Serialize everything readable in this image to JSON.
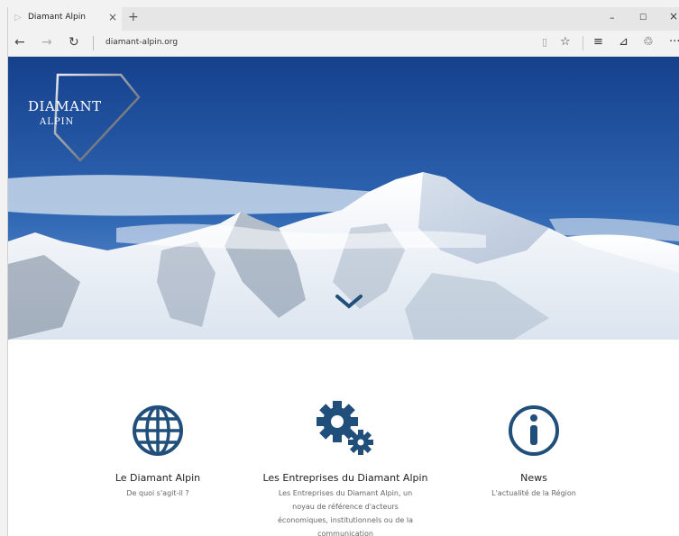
{
  "browser": {
    "tab_title": "Diamant Alpin",
    "tab_close": "×",
    "new_tab": "+",
    "url": "diamant-alpin.org",
    "minimize": "–",
    "maximize": "☐",
    "close": "×",
    "more": "···"
  },
  "hero": {
    "logo_line1": "DIAMANT",
    "logo_line2": "ALPIN"
  },
  "features": [
    {
      "title": "Le Diamant Alpin",
      "desc": "De quoi s'agit-il ?"
    },
    {
      "title": "Les Entreprises du Diamant Alpin",
      "desc_lines": [
        "Les Entreprises du Diamant Alpin, un",
        "noyau de référence d'acteurs",
        "économiques, institutionnels ou de la",
        "communication"
      ]
    },
    {
      "title": "News",
      "desc": "L'actualité de la Région"
    }
  ],
  "colors": {
    "icon_blue": "#1f4f7a",
    "sky_top": "#1a4a96",
    "sky_bottom": "#4a82c4"
  }
}
